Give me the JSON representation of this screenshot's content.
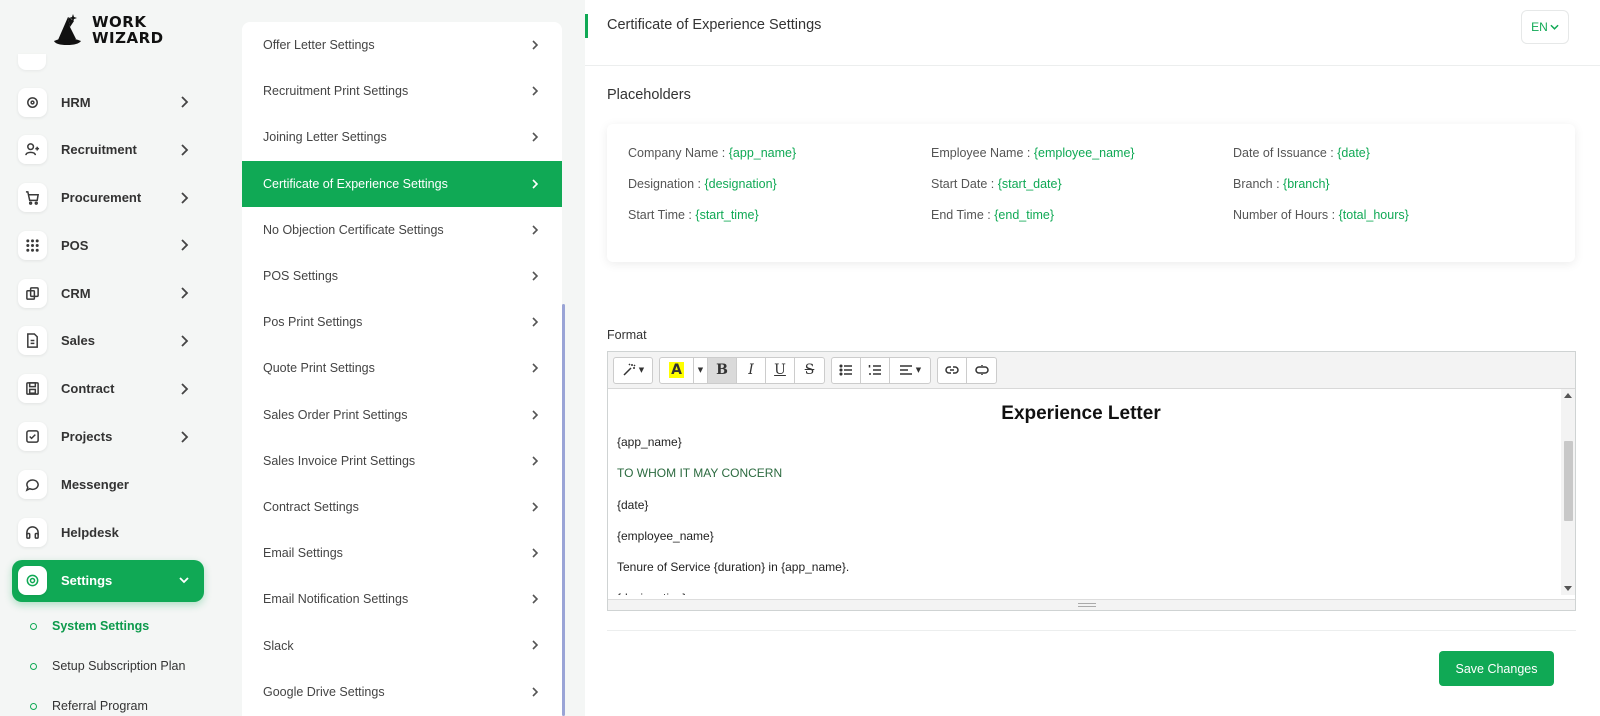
{
  "brand": {
    "line1": "WORK",
    "line2": "WIZARD"
  },
  "nav": {
    "items": [
      {
        "label": "HRM",
        "icon": "hrm-icon"
      },
      {
        "label": "Recruitment",
        "icon": "user-plus-icon"
      },
      {
        "label": "Procurement",
        "icon": "cart-icon"
      },
      {
        "label": "POS",
        "icon": "grid-icon"
      },
      {
        "label": "CRM",
        "icon": "layers-icon"
      },
      {
        "label": "Sales",
        "icon": "file-icon"
      },
      {
        "label": "Contract",
        "icon": "save-icon"
      },
      {
        "label": "Projects",
        "icon": "checkbox-icon"
      },
      {
        "label": "Messenger",
        "icon": "chat-icon"
      },
      {
        "label": "Helpdesk",
        "icon": "headset-icon"
      },
      {
        "label": "Settings",
        "icon": "gear-icon",
        "active": true
      }
    ],
    "sub_items": [
      {
        "label": "System Settings",
        "active": true
      },
      {
        "label": "Setup Subscription Plan"
      },
      {
        "label": "Referral Program"
      }
    ]
  },
  "settings_menu": {
    "items": [
      {
        "label": "Offer Letter Settings"
      },
      {
        "label": "Recruitment Print Settings"
      },
      {
        "label": "Joining Letter Settings"
      },
      {
        "label": "Certificate of Experience Settings",
        "active": true
      },
      {
        "label": "No Objection Certificate Settings"
      },
      {
        "label": "POS Settings"
      },
      {
        "label": "Pos Print Settings"
      },
      {
        "label": "Quote Print Settings"
      },
      {
        "label": "Sales Order Print Settings"
      },
      {
        "label": "Sales Invoice Print Settings"
      },
      {
        "label": "Contract Settings"
      },
      {
        "label": "Email Settings"
      },
      {
        "label": "Email Notification Settings"
      },
      {
        "label": "Slack"
      },
      {
        "label": "Google Drive Settings"
      }
    ]
  },
  "header": {
    "title": "Certificate of Experience Settings",
    "language": "EN"
  },
  "placeholders": {
    "title": "Placeholders",
    "items": [
      {
        "label": "Company Name : ",
        "value": "{app_name}"
      },
      {
        "label": "Employee Name : ",
        "value": "{employee_name}"
      },
      {
        "label": "Date of Issuance : ",
        "value": "{date}"
      },
      {
        "label": "Designation : ",
        "value": "{designation}"
      },
      {
        "label": "Start Date : ",
        "value": "{start_date}"
      },
      {
        "label": "Branch : ",
        "value": "{branch}"
      },
      {
        "label": "Start Time : ",
        "value": "{start_time}"
      },
      {
        "label": "End Time : ",
        "value": "{end_time}"
      },
      {
        "label": "Number of Hours : ",
        "value": "{total_hours}"
      }
    ]
  },
  "format": {
    "label": "Format",
    "toolbar": {
      "bold": "B",
      "italic": "I",
      "underline": "U",
      "strike": "S"
    },
    "document": {
      "heading": "Experience Letter",
      "lines": [
        "{app_name}",
        "TO WHOM IT MAY CONCERN",
        "{date}",
        "{employee_name}",
        "Tenure of Service {duration} in {app_name}.",
        "{designation}"
      ]
    }
  },
  "actions": {
    "save_label": "Save Changes"
  },
  "colors": {
    "accent": "#10a955",
    "text": "#333333",
    "background": "#f4f6f5"
  }
}
